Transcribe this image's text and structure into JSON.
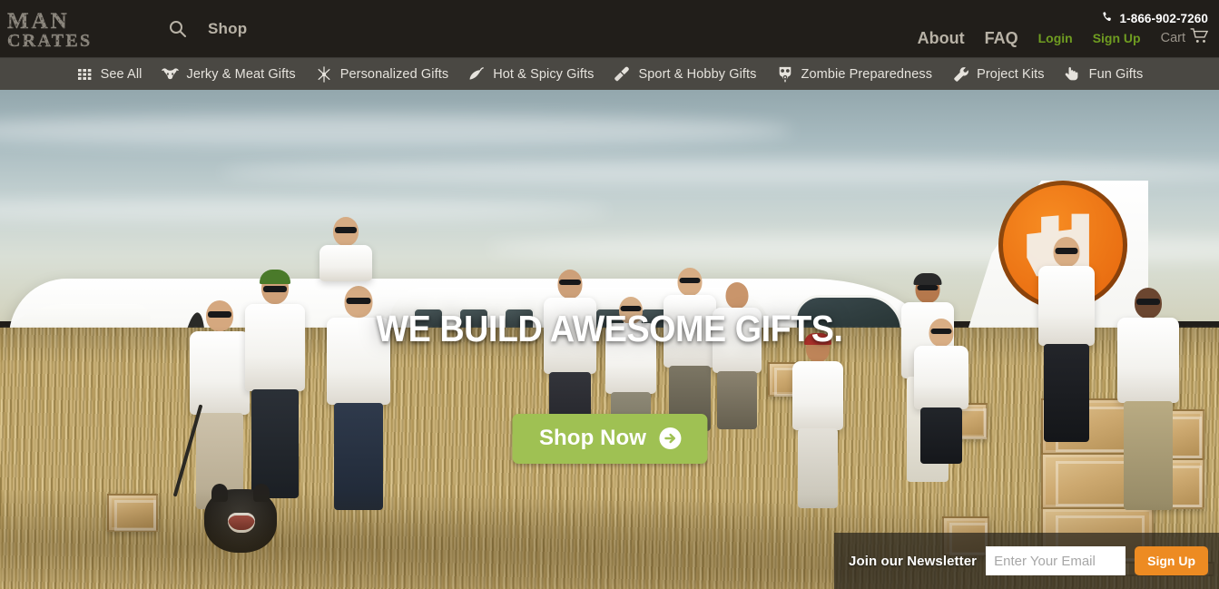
{
  "header": {
    "logo_line1": "MAN",
    "logo_line2": "CRATES",
    "search_icon": "search-icon",
    "shop_label": "Shop",
    "phone_icon": "phone-icon",
    "phone": "1-866-902-7260",
    "about_label": "About",
    "faq_label": "FAQ",
    "login_label": "Login",
    "signup_label": "Sign Up",
    "cart_label": "Cart",
    "cart_icon": "shopping-cart-icon",
    "bg_color": "#211e1a",
    "link_color": "#b8b2a6",
    "accent_green": "#6f9c21"
  },
  "catnav": {
    "bg_color": "#4a4843",
    "items": [
      {
        "label": "See All",
        "icon": "grid-icon"
      },
      {
        "label": "Jerky & Meat Gifts",
        "icon": "bull-skull-icon"
      },
      {
        "label": "Personalized Gifts",
        "icon": "sparkle-burst-icon"
      },
      {
        "label": "Hot & Spicy Gifts",
        "icon": "chili-pepper-icon"
      },
      {
        "label": "Sport & Hobby Gifts",
        "icon": "bat-paddle-icon"
      },
      {
        "label": "Zombie Preparedness",
        "icon": "gas-mask-icon"
      },
      {
        "label": "Project Kits",
        "icon": "wrench-icon"
      },
      {
        "label": "Fun Gifts",
        "icon": "hand-pointer-icon"
      }
    ]
  },
  "hero": {
    "headline": "WE BUILD AWESOME GIFTS.",
    "cta_label": "Shop Now",
    "cta_icon": "arrow-circle-right-icon",
    "cta_color": "#9fc153",
    "scene_description": "Group of men in white shirts posing in a golden grass field in front of a white airplane with orange stripe",
    "tail_logo_color": "#ea6f12"
  },
  "newsletter": {
    "label": "Join our Newsletter",
    "input_value": "",
    "input_placeholder": "Enter Your Email",
    "button_label": "Sign Up",
    "button_color": "#ed8b22"
  }
}
